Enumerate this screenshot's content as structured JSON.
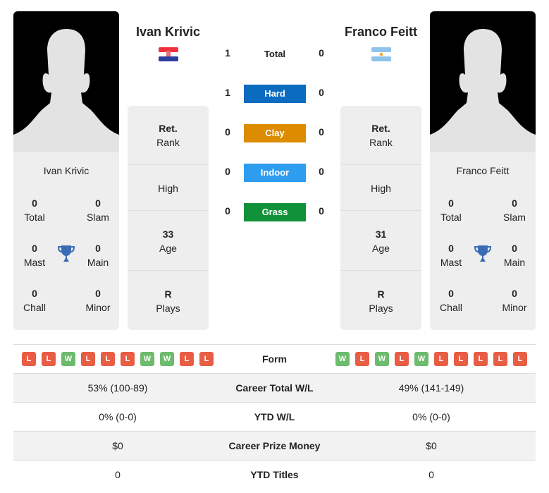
{
  "players": [
    {
      "name": "Ivan Krivic",
      "country": "Croatia",
      "flag_icon": "croatia-flag-icon",
      "titles": {
        "total": "0",
        "slam": "0",
        "mast": "0",
        "main": "0",
        "chall": "0",
        "minor": "0"
      },
      "rank": {
        "value": "Ret.",
        "label": "Rank"
      },
      "high": {
        "label": "High"
      },
      "age": {
        "value": "33",
        "label": "Age"
      },
      "plays": {
        "value": "R",
        "label": "Plays"
      },
      "form": [
        "L",
        "L",
        "W",
        "L",
        "L",
        "L",
        "W",
        "W",
        "L",
        "L"
      ],
      "career_wl": "53% (100-89)",
      "ytd_wl": "0% (0-0)",
      "prize": "$0",
      "ytd_titles": "0"
    },
    {
      "name": "Franco Feitt",
      "country": "Argentina",
      "flag_icon": "argentina-flag-icon",
      "titles": {
        "total": "0",
        "slam": "0",
        "mast": "0",
        "main": "0",
        "chall": "0",
        "minor": "0"
      },
      "rank": {
        "value": "Ret.",
        "label": "Rank"
      },
      "high": {
        "label": "High"
      },
      "age": {
        "value": "31",
        "label": "Age"
      },
      "plays": {
        "value": "R",
        "label": "Plays"
      },
      "form": [
        "W",
        "L",
        "W",
        "L",
        "W",
        "L",
        "L",
        "L",
        "L",
        "L"
      ],
      "career_wl": "49% (141-149)",
      "ytd_wl": "0% (0-0)",
      "prize": "$0",
      "ytd_titles": "0"
    }
  ],
  "title_labels": {
    "total": "Total",
    "slam": "Slam",
    "mast": "Mast",
    "main": "Main",
    "chall": "Chall",
    "minor": "Minor"
  },
  "h2h": [
    {
      "label": "Total",
      "p1": "1",
      "p2": "0",
      "color": null
    },
    {
      "label": "Hard",
      "p1": "1",
      "p2": "0",
      "color": "#0a6bbf"
    },
    {
      "label": "Clay",
      "p1": "0",
      "p2": "0",
      "color": "#dd8c00"
    },
    {
      "label": "Indoor",
      "p1": "0",
      "p2": "0",
      "color": "#2e9df0"
    },
    {
      "label": "Grass",
      "p1": "0",
      "p2": "0",
      "color": "#11923a"
    }
  ],
  "compare_rows": {
    "form": "Form",
    "career_wl": "Career Total W/L",
    "ytd_wl": "YTD W/L",
    "prize": "Career Prize Money",
    "ytd_titles": "YTD Titles"
  },
  "colors": {
    "loss": "#e95d45",
    "win": "#6dbb6d",
    "trophy": "#3a6cb5"
  }
}
